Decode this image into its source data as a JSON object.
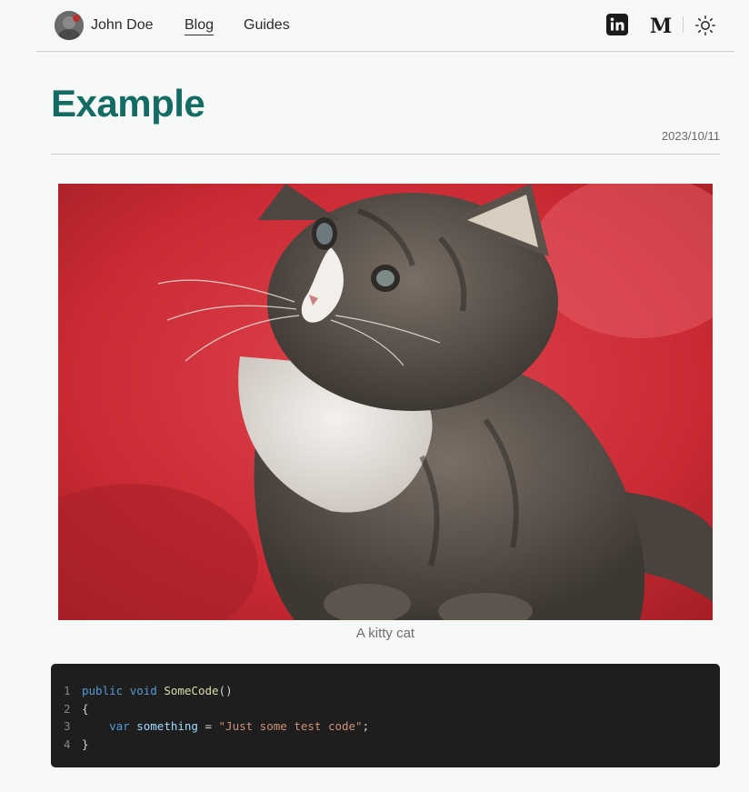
{
  "header": {
    "author_name": "John Doe",
    "nav": [
      {
        "label": "Blog",
        "active": true
      },
      {
        "label": "Guides",
        "active": false
      }
    ],
    "icons": [
      "linkedin-icon",
      "medium-icon",
      "sun-icon"
    ]
  },
  "post": {
    "title": "Example",
    "date": "2023/10/11",
    "image_caption": "A kitty cat"
  },
  "code": {
    "line_numbers": [
      "1",
      "2",
      "3",
      "4"
    ],
    "line1": {
      "kw1": "public",
      "kw2": "void",
      "fn": "SomeCode",
      "punct": "()"
    },
    "line2": {
      "text": "{"
    },
    "line3": {
      "indent": "    ",
      "kw": "var",
      "var": "something",
      "op": " = ",
      "str": "\"Just some test code\"",
      "end": ";"
    },
    "line4": {
      "text": "}"
    }
  },
  "colors": {
    "accent": "#136b64",
    "background": "#f6f8f8",
    "code_bg": "#1e1e1e",
    "cat_backdrop": "#d8323c"
  }
}
